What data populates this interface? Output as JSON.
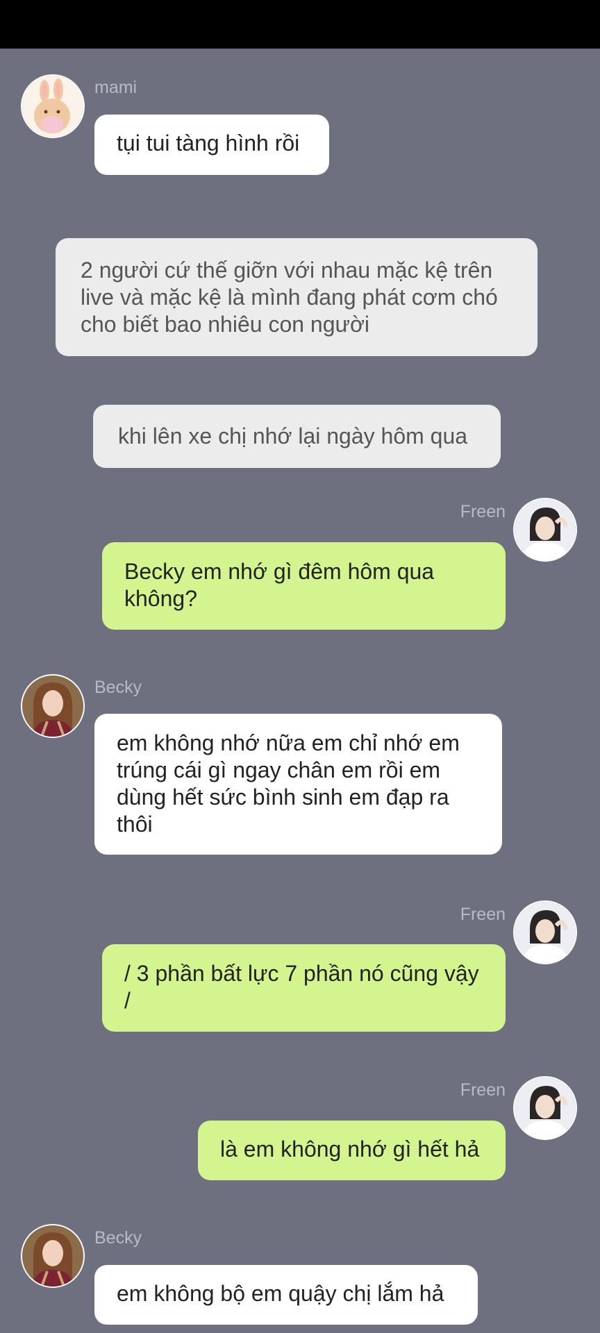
{
  "colors": {
    "background": "#6e7080",
    "top_bar": "#000000",
    "incoming_bubble": "#ffffff",
    "outgoing_bubble": "#d3f48e",
    "narration_bubble": "#ececec",
    "name_text": "#b8bac6"
  },
  "messages": [
    {
      "type": "incoming",
      "sender": "mami",
      "avatar": "bunny-avatar-icon",
      "text": "tụi tui tàng hình rồi"
    },
    {
      "type": "narration",
      "text": "2 người cứ thế giỡn với nhau mặc kệ trên live và mặc kệ là mình đang phát cơm chó cho biết bao nhiêu con người"
    },
    {
      "type": "narration",
      "text": "khi lên xe chị nhớ lại ngày hôm qua"
    },
    {
      "type": "outgoing",
      "sender": "Freen",
      "avatar": "freen-photo",
      "text": "Becky em nhớ gì đêm hôm qua không?"
    },
    {
      "type": "incoming",
      "sender": "Becky",
      "avatar": "becky-photo",
      "text": "em không nhớ nữa em chỉ nhớ em trúng cái gì ngay chân em rồi em dùng hết sức bình sinh em đạp ra thôi"
    },
    {
      "type": "outgoing",
      "sender": "Freen",
      "avatar": "freen-photo",
      "text": "/ 3 phần bất lực 7 phần nó cũng vậy /"
    },
    {
      "type": "outgoing",
      "sender": "Freen",
      "avatar": "freen-photo",
      "text": "là em không nhớ gì hết hả"
    },
    {
      "type": "incoming",
      "sender": "Becky",
      "avatar": "becky-photo",
      "text": "em không bộ em quậy chị lắm hả"
    }
  ]
}
